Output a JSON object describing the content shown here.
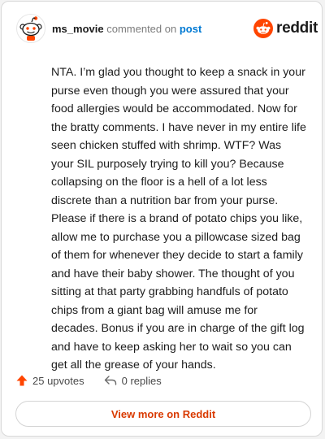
{
  "comment": {
    "username": "ms_movie",
    "commented_on_text": "commented on",
    "post_link": "post",
    "body": "NTA. I’m glad you thought to keep a snack in your purse even though you were assured that your food allergies would be accommodated. Now for the bratty comments. I have never in my entire life seen chicken stuffed with shrimp. WTF? Was your SIL purposely trying to kill you? Because collapsing on the floor is a hell of a lot less discrete than a nutrition bar from your purse. Please if there is a brand of potato chips you like, allow me to purchase you a pillowcase sized bag of them for whenever they decide to start a family and have their baby shower. The thought of you sitting at that party grabbing handfuls of potato chips from a giant bag will amuse me for decades. Bonus if you are in charge of the gift log and have to keep asking her to wait so you can get all the grease of your hands."
  },
  "brand": {
    "wordmark": "reddit",
    "icon": "reddit-snoo-icon",
    "accent": "#ff4500"
  },
  "actions": {
    "upvotes": "25 upvotes",
    "upvote_icon": "upvote-arrow-icon",
    "replies": "0 replies",
    "reply_icon": "reply-arrow-icon"
  },
  "cta": {
    "label": "View more on Reddit",
    "color": "#d93a00"
  }
}
